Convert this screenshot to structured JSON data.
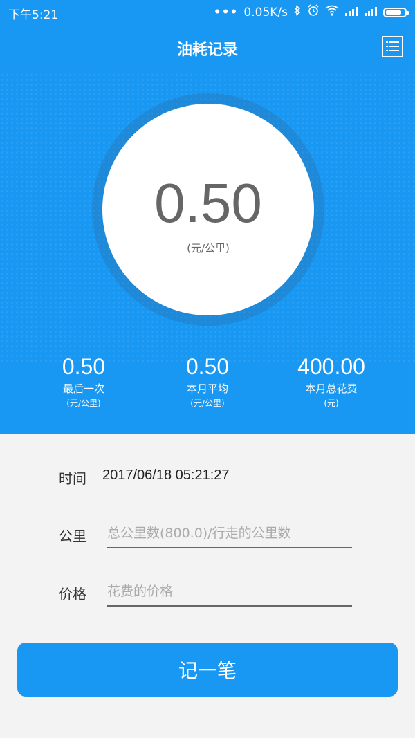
{
  "statusbar": {
    "time": "下午5:21",
    "dots": "•••",
    "speed": "0.05K/s"
  },
  "header": {
    "title": "油耗记录",
    "menu_icon": "list-icon"
  },
  "gauge": {
    "value": "0.50",
    "unit": "(元/公里)"
  },
  "stats": [
    {
      "value": "0.50",
      "label": "最后一次",
      "unit": "(元/公里)"
    },
    {
      "value": "0.50",
      "label": "本月平均",
      "unit": "(元/公里)"
    },
    {
      "value": "400.00",
      "label": "本月总花费",
      "unit": "(元)"
    }
  ],
  "form": {
    "time_label": "时间",
    "time_value": "2017/06/18 05:21:27",
    "km_label": "公里",
    "km_placeholder": "总公里数(800.0)/行走的公里数",
    "price_label": "价格",
    "price_placeholder": "花费的价格",
    "submit_label": "记一笔"
  },
  "colors": {
    "primary": "#1898f2",
    "background": "#f3f3f3"
  }
}
